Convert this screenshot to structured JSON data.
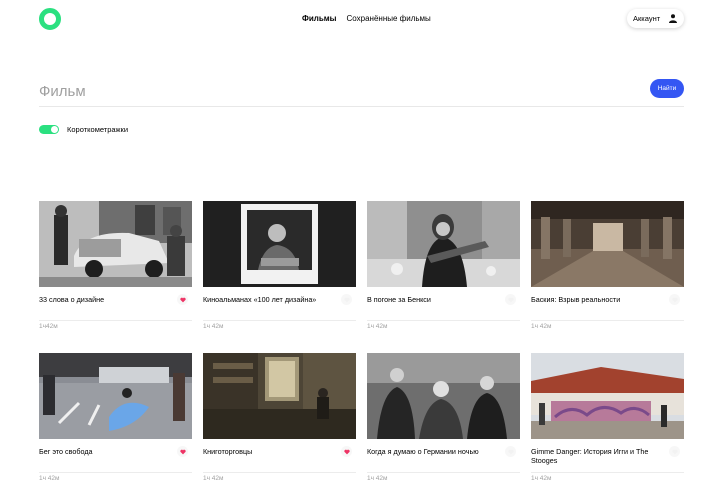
{
  "header": {
    "nav": [
      {
        "label": "Фильмы",
        "active": true
      },
      {
        "label": "Сохранённые фильмы",
        "active": false
      }
    ],
    "account_label": "Аккаунт",
    "accent_color": "#2be080"
  },
  "search": {
    "placeholder": "Фильм",
    "button_label": "Найти",
    "button_color": "#3456f3"
  },
  "filter": {
    "label": "Короткометражки",
    "enabled": true
  },
  "movies": [
    {
      "title": "33 слова о дизайне",
      "duration": "1ч42м",
      "liked": true
    },
    {
      "title": "Киноальманах «100 лет дизайна»",
      "duration": "1ч 42м",
      "liked": false
    },
    {
      "title": "В погоне за Бенкси",
      "duration": "1ч 42м",
      "liked": false
    },
    {
      "title": "Баския: Взрыв реальности",
      "duration": "1ч 42м",
      "liked": false
    },
    {
      "title": "Бег это свобода",
      "duration": "1ч 42м",
      "liked": true
    },
    {
      "title": "Книготорговцы",
      "duration": "1ч 42м",
      "liked": true
    },
    {
      "title": "Когда я думаю о Германии ночью",
      "duration": "1ч 42м",
      "liked": false
    },
    {
      "title": "Gimme Danger: История Игги и The Stooges",
      "duration": "1ч 42м",
      "liked": false
    }
  ]
}
